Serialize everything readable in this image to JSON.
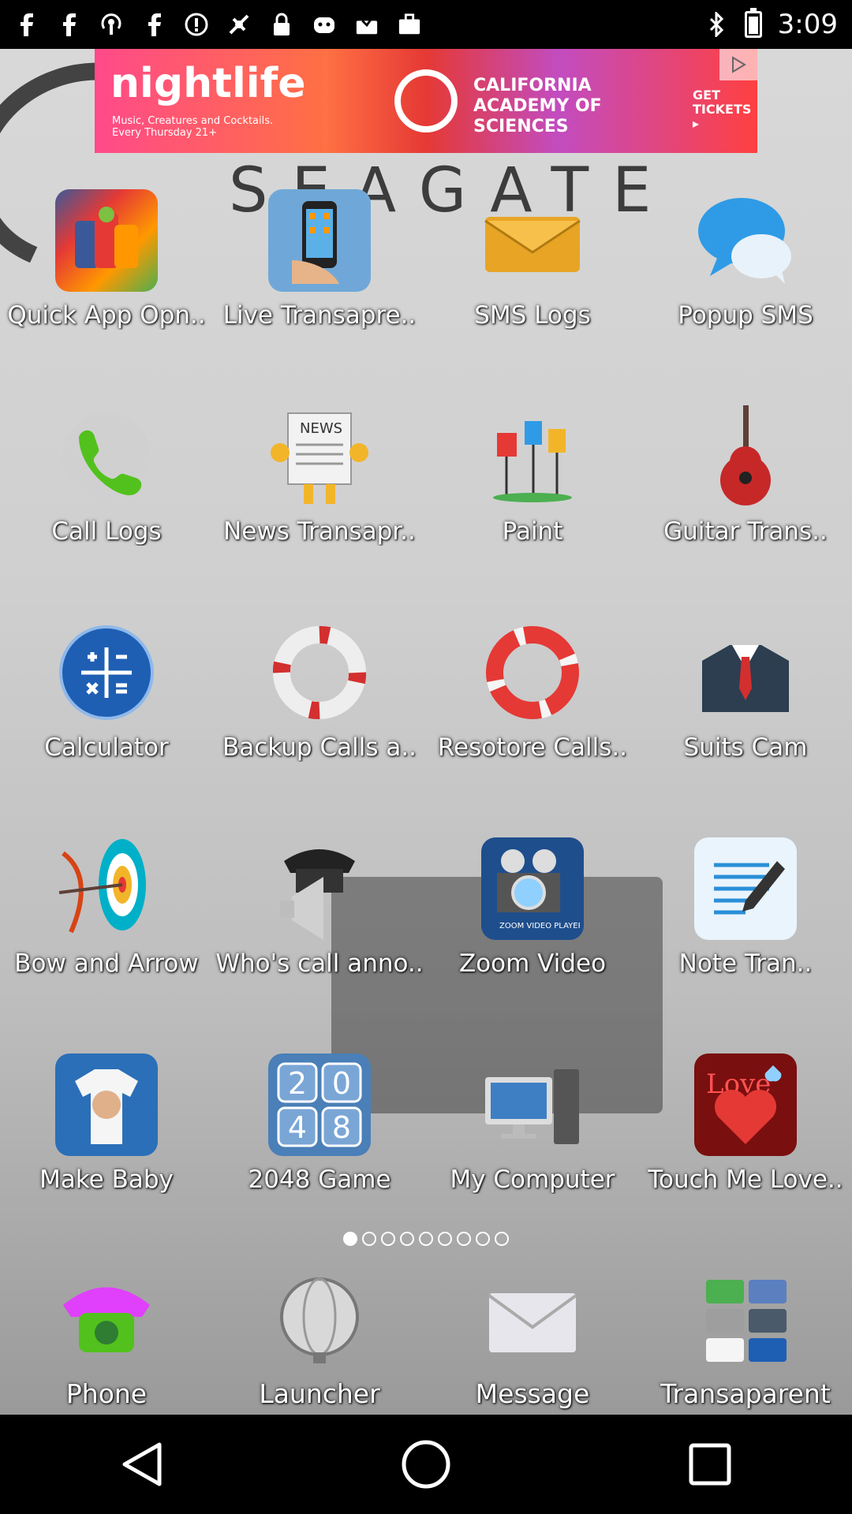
{
  "status_bar": {
    "time": "3:09",
    "icons": [
      "facebook-icon",
      "facebook-icon",
      "podcast-icon",
      "facebook-icon",
      "info-icon",
      "fake-gps-icon",
      "lock-icon",
      "game-icon",
      "inbox-icon",
      "briefcase-icon"
    ]
  },
  "ad": {
    "title": "nightlife",
    "subtitle": "Music, Creatures and Cocktails. Every Thursday 21+",
    "org": "CALIFORNIA ACADEMY OF SCIENCES",
    "cta": "GET TICKETS ▸"
  },
  "wallpaper": {
    "brand": "SEAGATE"
  },
  "apps": [
    {
      "label": "Quick App Opn..",
      "icon": "app-bundle-icon",
      "color": "#4caf50"
    },
    {
      "label": "Live Transapre..",
      "icon": "phone-hand-icon",
      "color": "#4a90c2"
    },
    {
      "label": "SMS  Logs",
      "icon": "envelope-icon",
      "color": "#f2b52a"
    },
    {
      "label": "Popup SMS",
      "icon": "chat-bubbles-icon",
      "color": "#2f9be6"
    },
    {
      "label": "Call Logs",
      "icon": "phone-icon",
      "color": "#52c11d"
    },
    {
      "label": "News Transapr..",
      "icon": "newspaper-icon",
      "color": "#f2b52a"
    },
    {
      "label": "Paint",
      "icon": "paint-icon",
      "color": "#e53935"
    },
    {
      "label": "Guitar Trans..",
      "icon": "guitar-icon",
      "color": "#c62828"
    },
    {
      "label": "Calculator",
      "icon": "calculator-icon",
      "color": "#1e5fb4"
    },
    {
      "label": "Backup Calls a..",
      "icon": "lifebuoy-icon",
      "color": "#d32f2f"
    },
    {
      "label": "Resotore Calls..",
      "icon": "lifebuoy-icon",
      "color": "#e53935"
    },
    {
      "label": "Suits Cam",
      "icon": "suit-icon",
      "color": "#2c3e50"
    },
    {
      "label": "Bow and Arrow",
      "icon": "target-icon",
      "color": "#00b0c8"
    },
    {
      "label": "Who's call anno..",
      "icon": "telephone-speaker-icon",
      "color": "#555555"
    },
    {
      "label": "Zoom Video",
      "icon": "video-player-icon",
      "color": "#1f4e8c"
    },
    {
      "label": "Note Tran..",
      "icon": "notepad-icon",
      "color": "#2a8fd8"
    },
    {
      "label": "Make Baby",
      "icon": "baby-shirt-icon",
      "color": "#2b6fb8"
    },
    {
      "label": "2048 Game",
      "icon": "game-2048-icon",
      "color": "#4a7fb8"
    },
    {
      "label": "My Computer",
      "icon": "computer-icon",
      "color": "#3e7fc4"
    },
    {
      "label": "Touch Me Love..",
      "icon": "love-icon",
      "color": "#c62828"
    }
  ],
  "page_indicator": {
    "count": 9,
    "active": 0
  },
  "dock": [
    {
      "label": "Phone",
      "icon": "phone-icon",
      "color": "#52c11d"
    },
    {
      "label": "Launcher",
      "icon": "globe-icon",
      "color": "#9e9e9e"
    },
    {
      "label": "Message",
      "icon": "envelope-icon",
      "color": "#e0e0e0"
    },
    {
      "label": "Transaparent",
      "icon": "grid-icon",
      "color": "#1e5fb4"
    }
  ]
}
